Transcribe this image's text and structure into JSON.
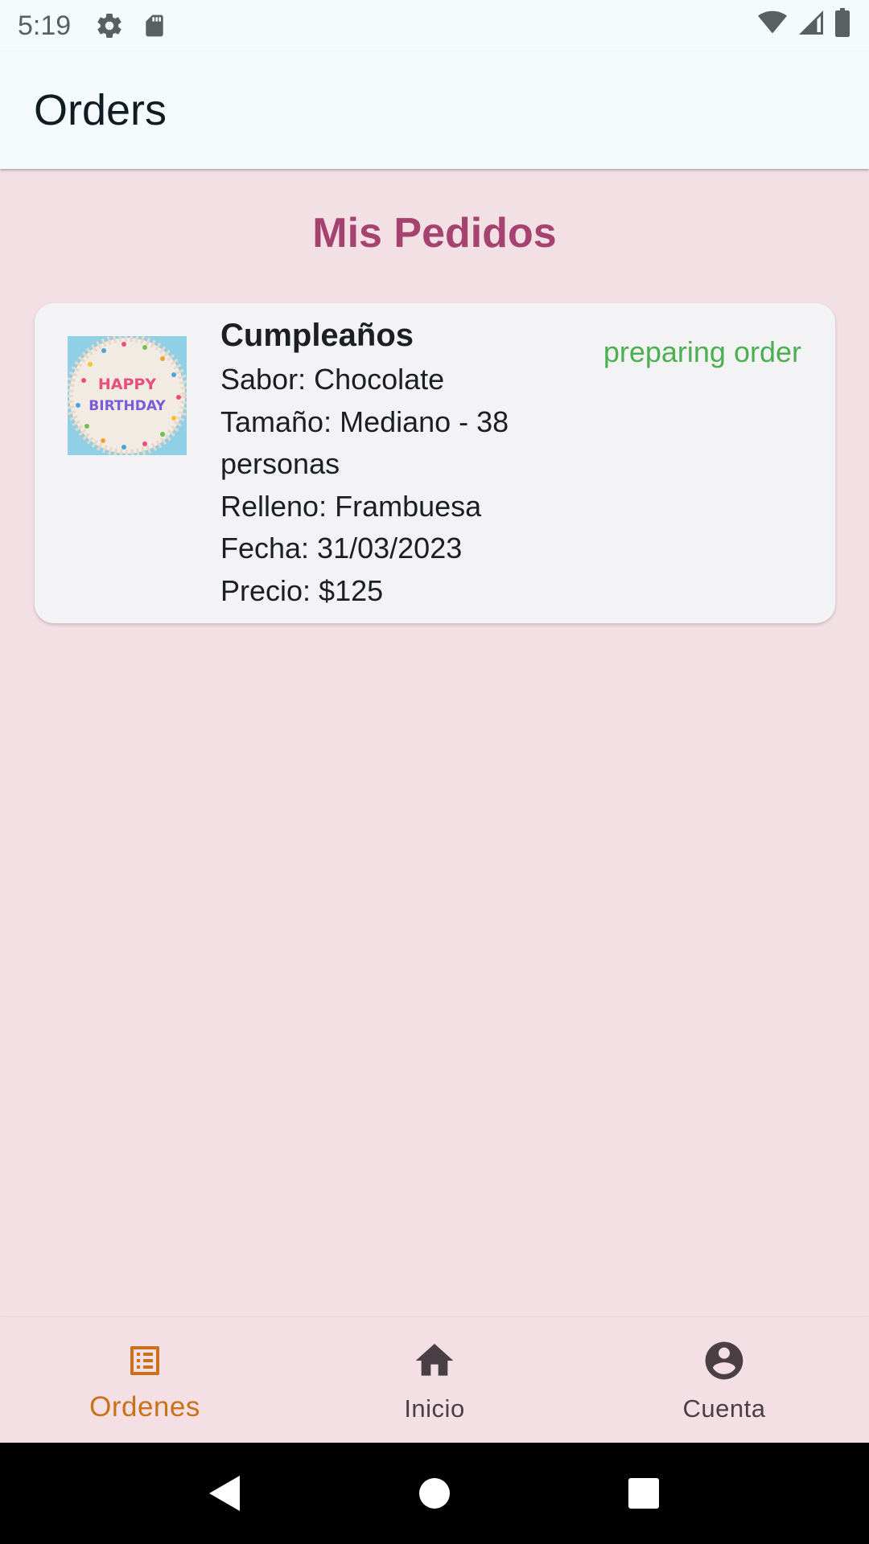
{
  "status_bar": {
    "time": "5:19",
    "icons": [
      "gear-icon",
      "sd-card-icon",
      "wifi-icon",
      "signal-icon",
      "battery-icon"
    ]
  },
  "app_bar": {
    "title": "Orders"
  },
  "main": {
    "section_title": "Mis Pedidos",
    "orders": [
      {
        "image_icon": "birthday-cake-image",
        "image_text": [
          "HAPPY",
          "BIRTHDAY"
        ],
        "title": "Cumpleaños",
        "flavor": "Sabor: Chocolate",
        "size_line1": "Tamaño: Mediano - 38",
        "size_line2": "personas",
        "filling": "Relleno: Frambuesa",
        "date": "Fecha: 31/03/2023",
        "price": "Precio: $125",
        "status": "preparing order"
      }
    ]
  },
  "bottom_nav": {
    "items": [
      {
        "label": "Ordenes",
        "icon": "list-icon",
        "active": true
      },
      {
        "label": "Inicio",
        "icon": "home-icon",
        "active": false
      },
      {
        "label": "Cuenta",
        "icon": "account-icon",
        "active": false
      }
    ]
  },
  "system_nav": {
    "buttons": [
      "back-icon",
      "home-circle-icon",
      "recents-icon"
    ]
  },
  "colors": {
    "accent_title": "#a6426f",
    "status_green": "#4caf50",
    "nav_active": "#c9721a",
    "background": "#f3e0e4"
  }
}
